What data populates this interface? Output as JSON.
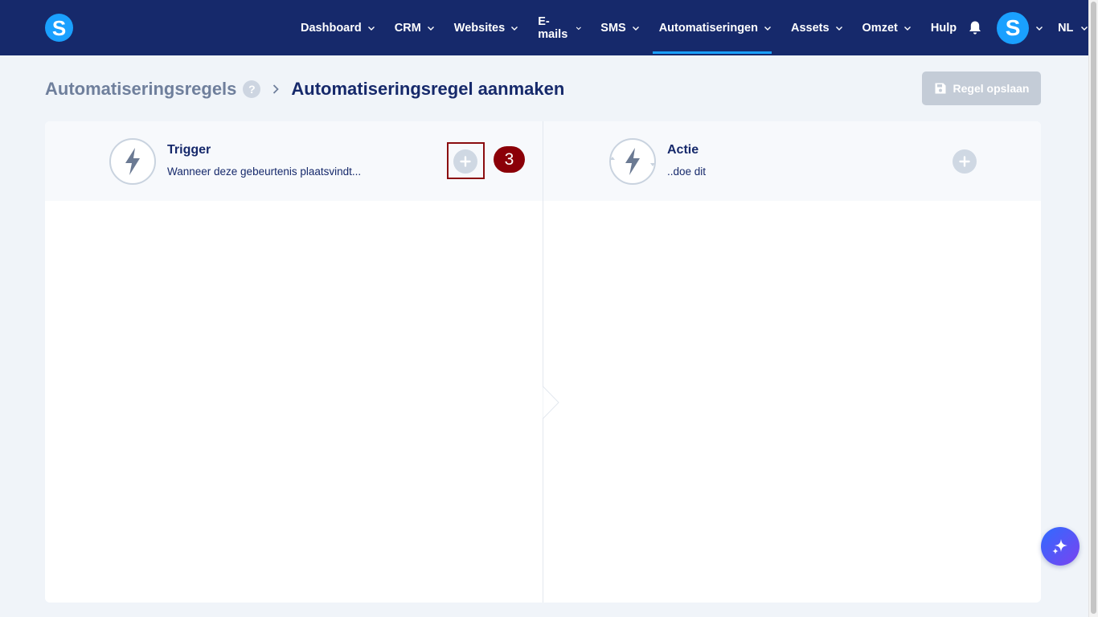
{
  "brand": {
    "letter": "S"
  },
  "nav": {
    "items": [
      {
        "label": "Dashboard",
        "has_dropdown": true
      },
      {
        "label": "CRM",
        "has_dropdown": true
      },
      {
        "label": "Websites",
        "has_dropdown": true
      },
      {
        "label": "E-mails",
        "has_dropdown": true
      },
      {
        "label": "SMS",
        "has_dropdown": true
      },
      {
        "label": "Automatiseringen",
        "has_dropdown": true,
        "active": true
      },
      {
        "label": "Assets",
        "has_dropdown": true
      },
      {
        "label": "Omzet",
        "has_dropdown": true
      },
      {
        "label": "Hulp",
        "has_dropdown": false
      }
    ],
    "bell_icon": "bell-icon",
    "avatar_letter": "S",
    "language": "NL"
  },
  "header": {
    "breadcrumb_parent": "Automatiseringsregels",
    "help_mark": "?",
    "breadcrumb_current": "Automatiseringsregel aanmaken",
    "save_label": "Regel opslaan"
  },
  "trigger": {
    "title": "Trigger",
    "subtitle": "Wanneer deze gebeurtenis plaatsvindt..."
  },
  "action": {
    "title": "Actie",
    "subtitle": "..doe dit"
  },
  "annotation": {
    "step_number": "3"
  },
  "colors": {
    "topbar": "#16296b",
    "accent": "#1aa0ff",
    "annotation": "#8b0008",
    "disabled_button": "#c4ccd7"
  }
}
